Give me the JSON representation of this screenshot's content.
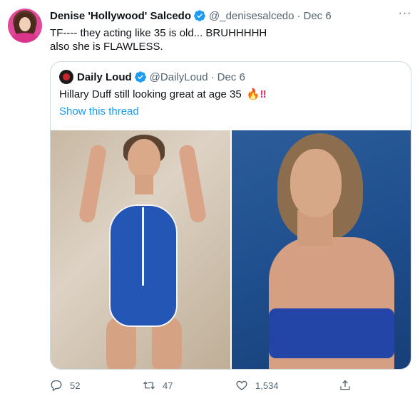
{
  "tweet": {
    "author_name": "Denise 'Hollywood' Salcedo",
    "author_handle": "@_denisesalcedo",
    "separator": "·",
    "date": "Dec 6",
    "text_line1": "TF---- they acting like 35 is old... BRUHHHHH",
    "text_line2": "also she is FLAWLESS.",
    "more_label": "···"
  },
  "quote": {
    "author_name": "Daily Loud",
    "author_handle": "@DailyLoud",
    "separator": "·",
    "date": "Dec 6",
    "text": "Hillary Duff still looking great at age 35",
    "emoji_fire": "🔥",
    "emoji_bang": "‼",
    "show_thread": "Show this thread"
  },
  "actions": {
    "reply_count": "52",
    "retweet_count": "47",
    "like_count": "1,534"
  },
  "icons": {
    "verified": "verified-badge-icon",
    "reply": "reply-icon",
    "retweet": "retweet-icon",
    "like": "heart-icon",
    "share": "share-icon",
    "more": "more-icon"
  },
  "colors": {
    "accent": "#1d9bf0",
    "text": "#0f1419",
    "muted": "#536471",
    "border": "#cfd9de"
  }
}
